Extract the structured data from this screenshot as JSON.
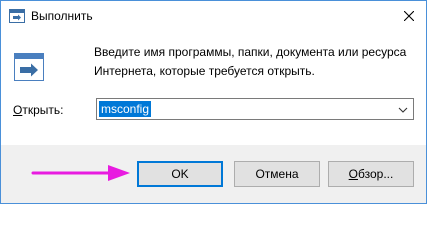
{
  "window": {
    "title": "Выполнить",
    "title_icon": "run-icon",
    "close_icon": "close-icon"
  },
  "dialog": {
    "icon": "run-dialog-icon",
    "description": "Введите имя программы, папки, документа или ресурса Интернета, которые требуется открыть.",
    "open_label_access": "О",
    "open_label_rest": "ткрыть:",
    "input_value": "msconfig",
    "dropdown_icon": "chevron-down-icon"
  },
  "buttons": {
    "ok": "OK",
    "cancel": "Отмена",
    "browse_access": "О",
    "browse_rest": "бзор..."
  },
  "annotation": {
    "arrow_color": "#e81be0"
  }
}
